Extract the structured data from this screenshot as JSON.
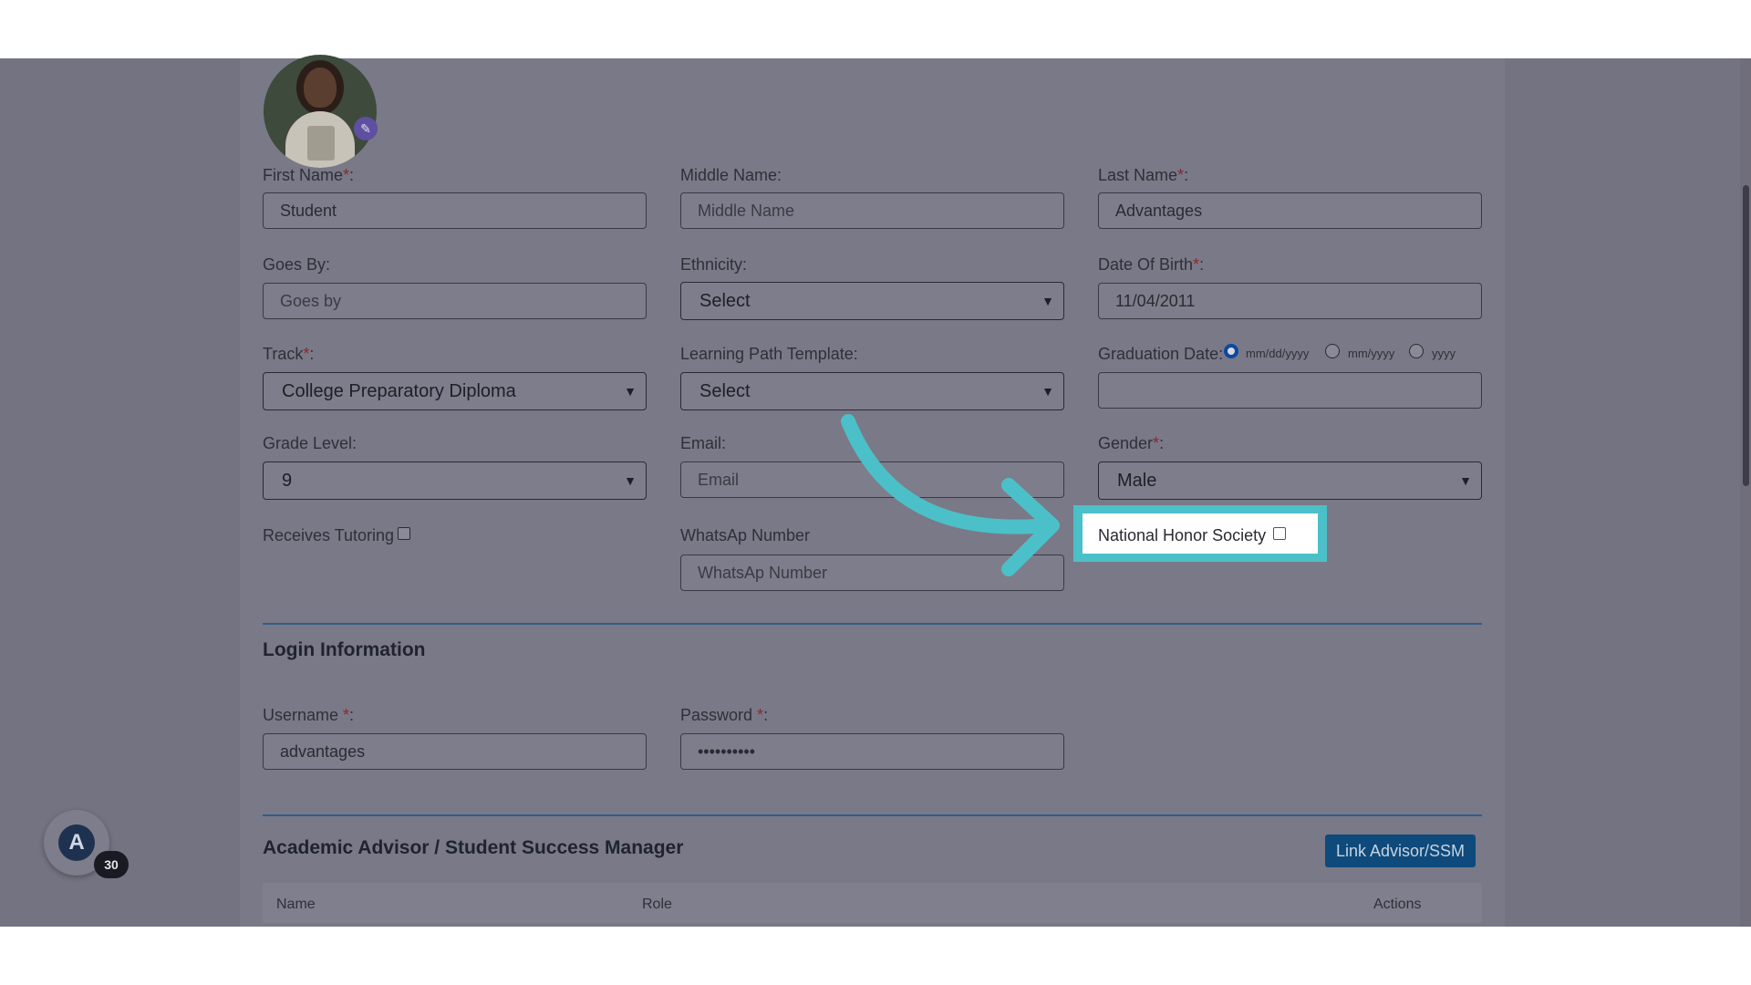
{
  "profile": {
    "avatar_alt": "Student photo",
    "edit_icon": "pencil-icon"
  },
  "form": {
    "first_name": {
      "label": "First Name",
      "req": "*",
      "suffix": ":",
      "value": "Student"
    },
    "middle_name": {
      "label": "Middle Name:",
      "placeholder": "Middle Name"
    },
    "last_name": {
      "label": "Last Name",
      "req": "*",
      "suffix": ":",
      "value": "Advantages"
    },
    "goes_by": {
      "label": "Goes By:",
      "placeholder": "Goes by"
    },
    "ethnicity": {
      "label": "Ethnicity:",
      "value": "Select"
    },
    "dob": {
      "label": "Date Of Birth",
      "req": "*",
      "suffix": ":",
      "value": "11/04/2011"
    },
    "track": {
      "label": "Track",
      "req": "*",
      "suffix": ":",
      "value": "College Preparatory Diploma"
    },
    "learning_path": {
      "label": "Learning Path Template:",
      "value": "Select"
    },
    "graduation": {
      "label": "Graduation Date:",
      "options": [
        "mm/dd/yyyy",
        "mm/yyyy",
        "yyyy"
      ],
      "selected": "mm/dd/yyyy",
      "value": ""
    },
    "grade": {
      "label": "Grade Level:",
      "value": "9"
    },
    "email": {
      "label": "Email:",
      "placeholder": "Email"
    },
    "gender": {
      "label": "Gender",
      "req": "*",
      "suffix": ":",
      "value": "Male"
    },
    "tutoring": {
      "label": "Receives Tutoring",
      "checked": false
    },
    "whatsapp": {
      "label": "WhatsAp Number",
      "placeholder": "WhatsAp Number"
    },
    "nhs": {
      "label": "National Honor Society",
      "checked": false
    }
  },
  "login": {
    "title": "Login Information",
    "username": {
      "label": "Username ",
      "req": "*",
      "suffix": ":",
      "value": "advantages"
    },
    "password": {
      "label": "Password ",
      "req": "*",
      "suffix": ":",
      "value": "••••••••••"
    }
  },
  "advisor": {
    "title": "Academic Advisor / Student Success Manager",
    "link_button": "Link Advisor/SSM",
    "columns": [
      "Name",
      "Role",
      "Actions"
    ]
  },
  "fab": {
    "count": "30",
    "logo": "A"
  },
  "colors": {
    "accent": "#4cc0c8",
    "primary": "#0e4a7c"
  }
}
